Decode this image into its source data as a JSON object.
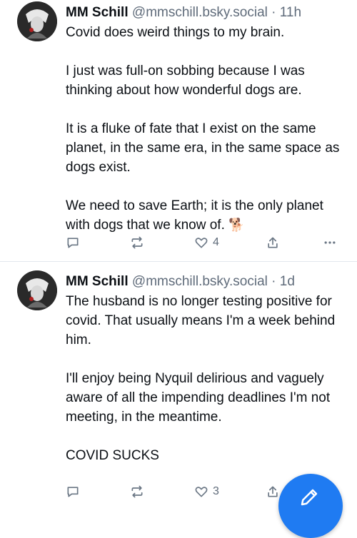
{
  "posts": [
    {
      "author": "MM Schill",
      "handle": "@mmschill.bsky.social",
      "separator": "·",
      "time": "11h",
      "paragraphs": [
        "Covid does weird things to my brain.",
        "I just was full-on sobbing because I was thinking about how wonderful dogs are.",
        "It is a fluke of fate that I exist on the same planet, in the same era, in the same space as dogs exist.",
        "We need to save Earth; it is the only planet with dogs that we know of."
      ],
      "emoji": "🐕",
      "actions": {
        "reply_count": "",
        "repost_count": "",
        "like_count": "4"
      }
    },
    {
      "author": "MM Schill",
      "handle": "@mmschill.bsky.social",
      "separator": "·",
      "time": "1d",
      "paragraphs": [
        "The husband is no longer testing positive for covid. That usually means I'm a week behind him.",
        "I'll enjoy being Nyquil delirious and vaguely aware of all the impending deadlines I'm not meeting, in the meantime.",
        "COVID SUCKS"
      ],
      "actions": {
        "reply_count": "",
        "repost_count": "",
        "like_count": "3"
      }
    }
  ],
  "colors": {
    "accent": "#1f7bf2",
    "meta": "#5f6b7a",
    "icon": "#6b7785",
    "divider": "#e3e8ee"
  },
  "icons": [
    "reply-icon",
    "repost-icon",
    "like-icon",
    "share-icon",
    "more-icon",
    "compose-icon"
  ]
}
